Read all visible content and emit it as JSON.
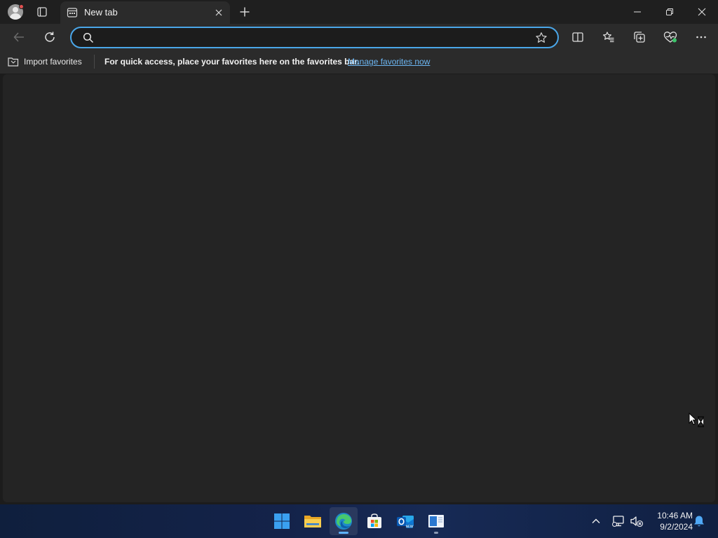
{
  "browser": {
    "tab": {
      "title": "New tab"
    },
    "address_bar": {
      "value": "",
      "placeholder": ""
    },
    "favorites_bar": {
      "import_label": "Import favorites",
      "message": "For quick access, place your favorites here on the favorites bar.",
      "manage_link": "Manage favorites now"
    },
    "icons": {
      "profile": "profile-avatar-icon",
      "tab_actions": "tab-actions-icon",
      "new_tab": "plus-icon",
      "back": "back-arrow-icon",
      "refresh": "refresh-icon",
      "search": "search-icon",
      "favorite": "star-icon",
      "split_screen": "split-screen-icon",
      "favorites": "favorites-icon",
      "collections": "collections-icon",
      "performance": "heart-pulse-icon",
      "more": "more-icon"
    }
  },
  "taskbar": {
    "apps": [
      {
        "name": "Start",
        "icon": "windows-logo-icon"
      },
      {
        "name": "File Explorer",
        "icon": "folder-icon"
      },
      {
        "name": "Microsoft Edge",
        "icon": "edge-icon",
        "active": true
      },
      {
        "name": "Microsoft Store",
        "icon": "store-icon"
      },
      {
        "name": "Outlook",
        "icon": "outlook-icon"
      },
      {
        "name": "App",
        "icon": "app-window-icon",
        "running": true
      }
    ],
    "clock": {
      "time": "10:46 AM",
      "date": "9/2/2024"
    }
  },
  "colors": {
    "accent": "#4aa6e8",
    "link": "#6cb6f2",
    "content_bg": "#242424",
    "chrome_bg": "#2b2b2b"
  }
}
